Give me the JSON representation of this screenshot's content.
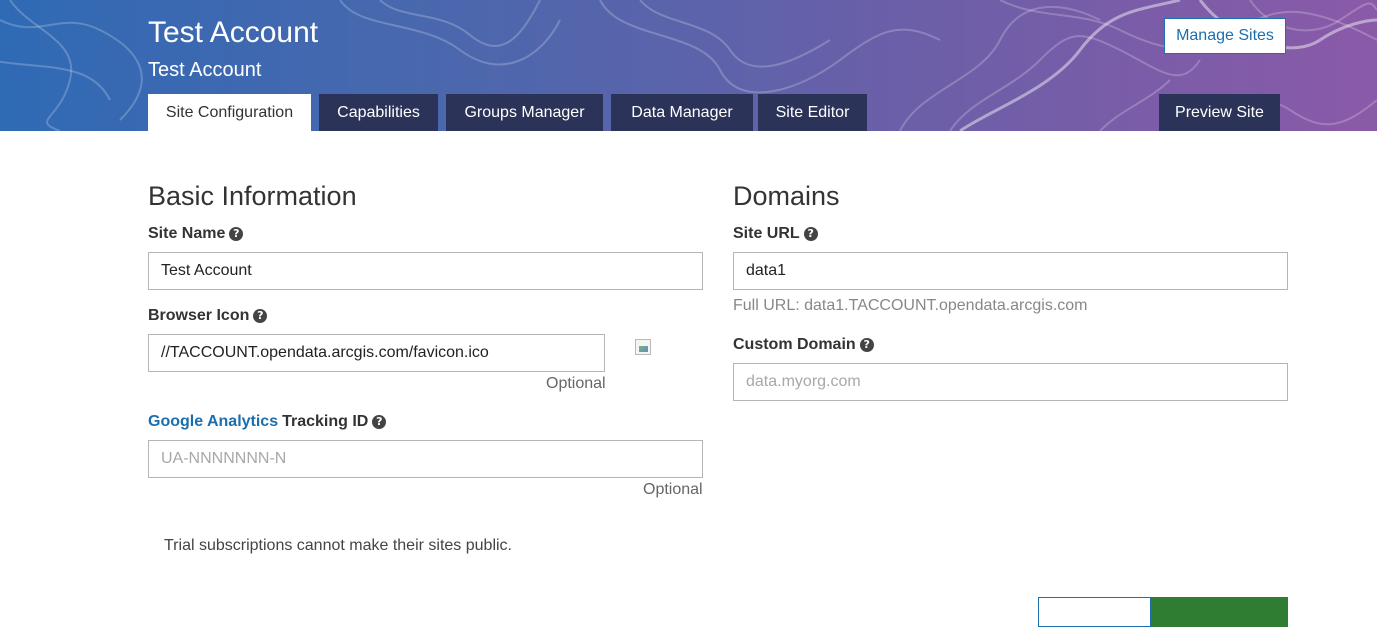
{
  "header": {
    "title": "Test Account",
    "subtitle": "Test Account",
    "manage_sites_label": "Manage Sites"
  },
  "tabs": [
    {
      "label": "Site Configuration",
      "active": true
    },
    {
      "label": "Capabilities",
      "active": false
    },
    {
      "label": "Groups Manager",
      "active": false
    },
    {
      "label": "Data Manager",
      "active": false
    },
    {
      "label": "Site Editor",
      "active": false
    }
  ],
  "preview_site_label": "Preview Site",
  "basic_info": {
    "heading": "Basic Information",
    "site_name": {
      "label": "Site Name",
      "value": "Test Account"
    },
    "browser_icon": {
      "label": "Browser Icon",
      "value": "//TACCOUNT.opendata.arcgis.com/favicon.ico",
      "hint": "Optional"
    },
    "tracking": {
      "link_label": "Google Analytics",
      "label": "Tracking ID",
      "placeholder": "UA-NNNNNNN-N",
      "hint": "Optional"
    }
  },
  "domains": {
    "heading": "Domains",
    "site_url": {
      "label": "Site URL",
      "value": "data1",
      "full_url": "Full URL: data1.TACCOUNT.opendata.arcgis.com"
    },
    "custom_domain": {
      "label": "Custom Domain",
      "placeholder": "data.myorg.com"
    }
  },
  "notice": "Trial subscriptions cannot make their sites public.",
  "icons": {
    "help": "question-circle-icon",
    "broken_image": "broken-image-icon"
  },
  "colors": {
    "accent": "#1b6fae",
    "tab_bg": "#2c3358",
    "save_green": "#2e7d32"
  }
}
